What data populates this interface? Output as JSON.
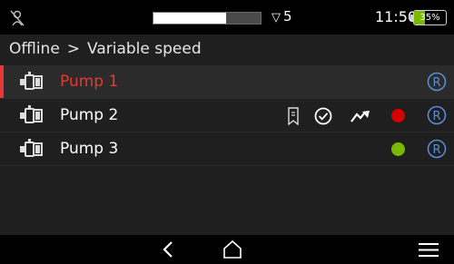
{
  "status": {
    "level_fraction": 0.68,
    "signal_value": "5",
    "time": "11:50",
    "battery_percent": "35%",
    "battery_fraction": 0.35
  },
  "breadcrumb": {
    "root": "Offline",
    "separator": ">",
    "current": "Variable speed"
  },
  "pumps": [
    {
      "name": "Pump 1",
      "selected": true,
      "indicators": [],
      "status_color": "",
      "remote": "R"
    },
    {
      "name": "Pump 2",
      "selected": false,
      "indicators": [
        "bookmark-icon",
        "check-circle-icon",
        "trend-up-icon"
      ],
      "status_color": "#d50000",
      "remote": "R"
    },
    {
      "name": "Pump 3",
      "selected": false,
      "indicators": [],
      "status_color": "#7ab800",
      "remote": "R"
    }
  ],
  "colors": {
    "accent_red": "#e53935",
    "remote_blue": "#5b8fd9",
    "battery_green": "#7ab800"
  },
  "navbar": {
    "back": "chevron-left-icon",
    "home": "home-icon",
    "menu": "menu-icon"
  }
}
